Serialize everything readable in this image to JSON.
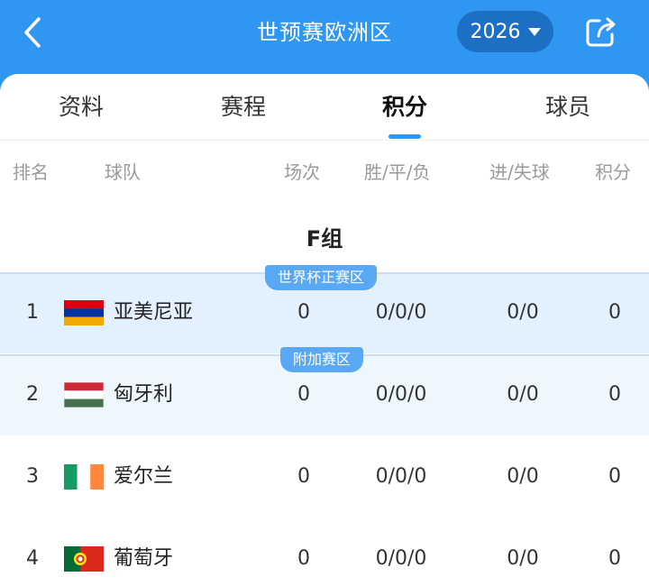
{
  "header": {
    "title": "世预赛欧洲区",
    "year": "2026"
  },
  "tabs": [
    {
      "label": "资料"
    },
    {
      "label": "赛程"
    },
    {
      "label": "积分"
    },
    {
      "label": "球员"
    }
  ],
  "active_tab": "积分",
  "columns": {
    "rank": "排名",
    "team": "球队",
    "games": "场次",
    "wdl": "胜/平/负",
    "goals": "进/失球",
    "points": "积分"
  },
  "group": {
    "title": "F组",
    "rows": [
      {
        "rank": "1",
        "team": "亚美尼亚",
        "games": "0",
        "wdl": "0/0/0",
        "goals": "0/0",
        "points": "0",
        "badge": "世界杯正赛区"
      },
      {
        "rank": "2",
        "team": "匈牙利",
        "games": "0",
        "wdl": "0/0/0",
        "goals": "0/0",
        "points": "0",
        "badge": "附加赛区"
      },
      {
        "rank": "3",
        "team": "爱尔兰",
        "games": "0",
        "wdl": "0/0/0",
        "goals": "0/0",
        "points": "0"
      },
      {
        "rank": "4",
        "team": "葡萄牙",
        "games": "0",
        "wdl": "0/0/0",
        "goals": "0/0",
        "points": "0"
      }
    ]
  },
  "colors": {
    "brand": "#2f97f1",
    "qualify_bg": "#e3f0fd",
    "playoff_bg": "#eef6fe",
    "badge": "#59a8f3"
  },
  "icons": {
    "back": "chevron-left-icon",
    "year_dropdown": "caret-down-icon",
    "share": "share-icon"
  }
}
